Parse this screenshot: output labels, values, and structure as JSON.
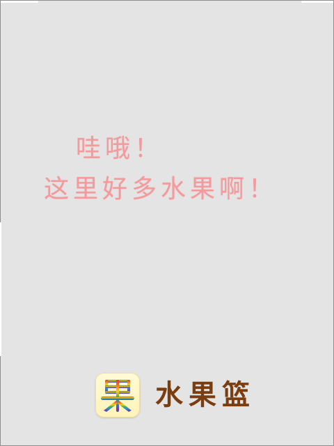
{
  "greeting": {
    "line1": "哇哦！",
    "line2": "这里好多水果啊！"
  },
  "brand": {
    "icon": "fruit-basket-rainbow-icon",
    "icon_glyph": "果",
    "name": "水果篮"
  },
  "colors": {
    "background": "#e4e4e4",
    "greeting_text": "#f39a9d",
    "brand_text": "#7a3d10",
    "icon_background": "#fff6c4"
  }
}
